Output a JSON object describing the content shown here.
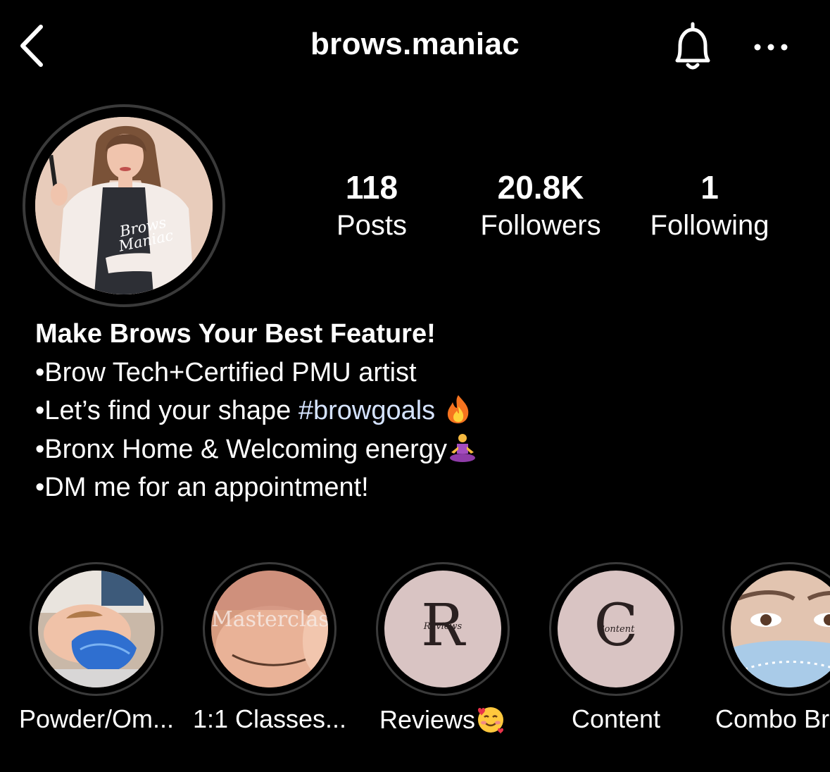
{
  "header": {
    "username": "brows.maniac",
    "icons": [
      "back-chevron-icon",
      "bell-icon",
      "more-icon"
    ]
  },
  "avatar": {
    "logo_line1": "Brows",
    "logo_line2": "Maniac"
  },
  "stats": [
    {
      "value": "118",
      "label": "Posts"
    },
    {
      "value": "20.8K",
      "label": "Followers"
    },
    {
      "value": "1",
      "label": "Following"
    }
  ],
  "bio": {
    "name": "Make Brows Your Best Feature!",
    "line1": "•Brow Tech+Certified PMU artist",
    "line2_text": "•Let’s find your shape ",
    "line2_hashtag": "#browgoals",
    "line3": "•Bronx Home & Welcoming energy",
    "line4": "•DM me for an appointment!",
    "emojis": [
      "fire-emoji",
      "person-meditating-emoji"
    ]
  },
  "highlights": [
    {
      "label": "Powder/Om..."
    },
    {
      "label": "1:1 Classes...",
      "cover_text": "Masterclass"
    },
    {
      "label": "Reviews",
      "cover_letter": "R",
      "cover_script": "Reviews",
      "emoji": "smiling-face-with-hearts-emoji"
    },
    {
      "label": "Content",
      "cover_letter": "C",
      "cover_script": "Content"
    },
    {
      "label": "Combo Br"
    }
  ],
  "colors": {
    "background": "#000000",
    "text": "#ffffff",
    "hashtag": "#d5e3ff",
    "ring": "#3a3a3a",
    "highlight_cover_pink": "#d9c4c3"
  }
}
